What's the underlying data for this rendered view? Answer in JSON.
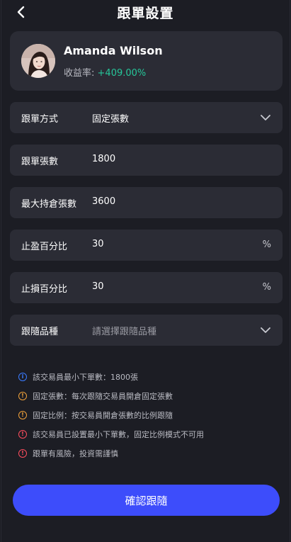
{
  "header": {
    "title": "跟單設置"
  },
  "trader": {
    "name": "Amanda Wilson",
    "yield_label": "收益率:",
    "yield_value": "+409.00%"
  },
  "form": {
    "mode": {
      "label": "跟單方式",
      "value": "固定張數"
    },
    "contracts": {
      "label": "跟單張數",
      "value": "1800"
    },
    "max_position": {
      "label": "最大持倉張數",
      "value": "3600"
    },
    "take_profit": {
      "label": "止盈百分比",
      "value": "30",
      "suffix": "%"
    },
    "stop_loss": {
      "label": "止損百分比",
      "value": "30",
      "suffix": "%"
    },
    "instruments": {
      "label": "跟隨品種",
      "placeholder": "請選擇跟隨品種"
    }
  },
  "notes": [
    {
      "type": "info",
      "text": "該交易員最小下單數：1800張"
    },
    {
      "type": "warn",
      "text": "固定張數：每次跟隨交易員開倉固定張數"
    },
    {
      "type": "warn",
      "text": "固定比例：按交易員開倉張數的比例跟隨"
    },
    {
      "type": "error",
      "text": "該交易員已設置最小下單數，固定比例模式不可用"
    },
    {
      "type": "error",
      "text": "跟單有風險，投資需謹慎"
    }
  ],
  "icons": {
    "info": "i",
    "warn": "!",
    "error": "!"
  },
  "confirm_label": "確認跟隨",
  "colors": {
    "accent": "#3d4dfb",
    "positive": "#26c79a",
    "card": "#2b2c35",
    "background": "#1c1d24"
  }
}
